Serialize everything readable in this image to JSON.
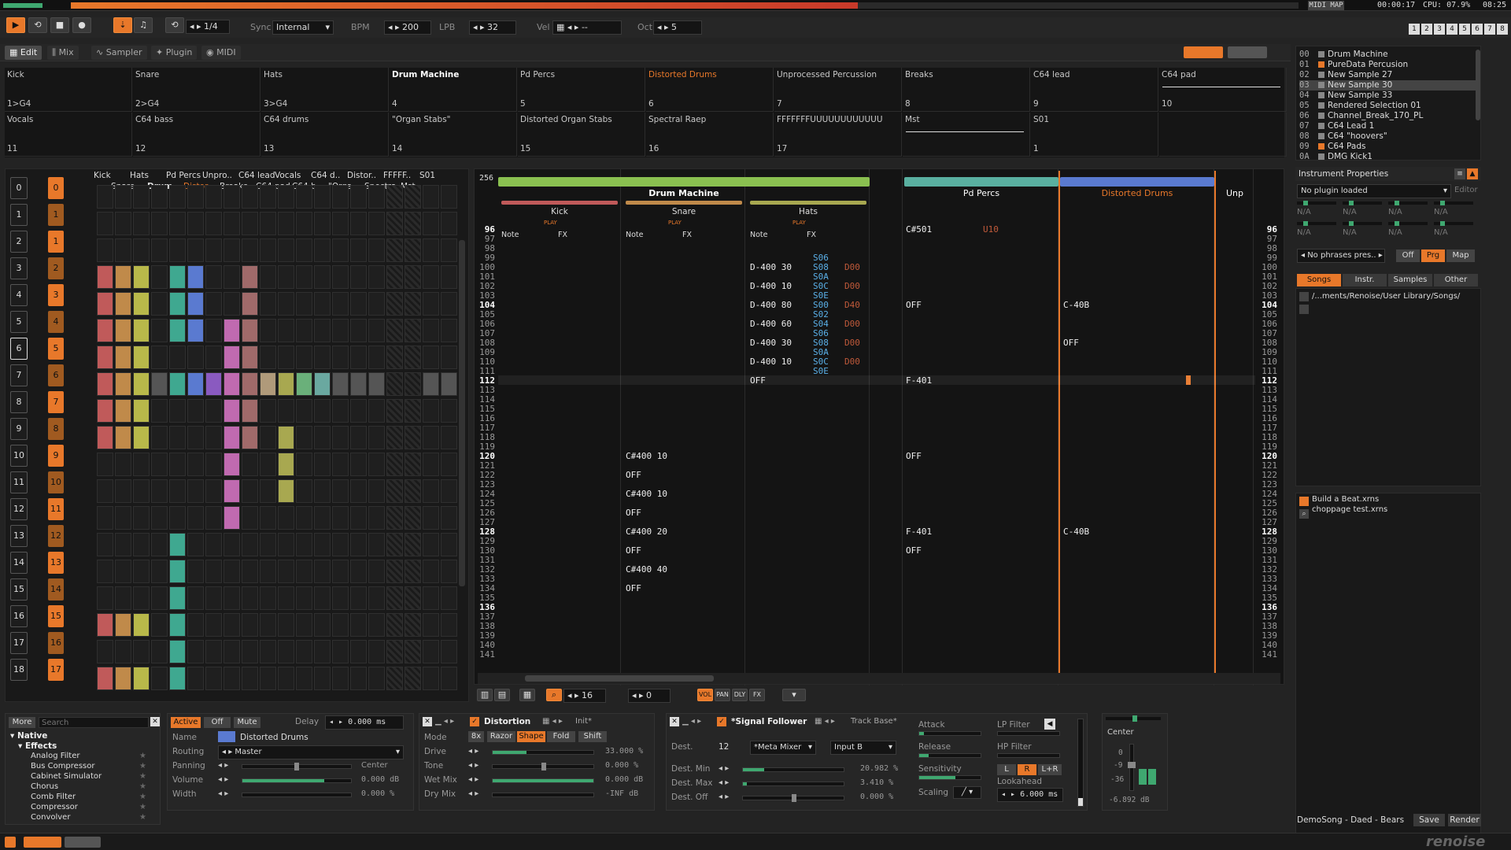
{
  "topbar": {
    "midi_map": "MIDI MAP",
    "time": "00:00:17",
    "cpu": "CPU: 07.9%",
    "clock": "08:25",
    "pages": [
      "1",
      "2",
      "3",
      "4",
      "5",
      "6",
      "7",
      "8"
    ]
  },
  "transport": {
    "pattern_pos": "1/4",
    "sync_label": "Sync",
    "sync_value": "Internal",
    "bpm_label": "BPM",
    "bpm": "200",
    "lpb_label": "LPB",
    "lpb": "32",
    "vel_label": "Vel",
    "vel": "--",
    "oct_label": "Oct",
    "oct": "5"
  },
  "tabs": {
    "edit": "Edit",
    "mix": "Mix",
    "sampler": "Sampler",
    "plugin": "Plugin",
    "midi": "MIDI"
  },
  "samples": [
    {
      "name": "Kick",
      "num": "1>G4"
    },
    {
      "name": "Snare",
      "num": "2>G4"
    },
    {
      "name": "Hats",
      "num": "3>G4"
    },
    {
      "name": "Drum Machine",
      "num": "4"
    },
    {
      "name": "Pd Percs",
      "num": "5"
    },
    {
      "name": "Distorted Drums",
      "num": "6"
    },
    {
      "name": "Unprocessed Percussion",
      "num": "7"
    },
    {
      "name": "Breaks",
      "num": "8"
    },
    {
      "name": "C64 lead",
      "num": "9"
    },
    {
      "name": "C64 pad",
      "num": "10"
    },
    {
      "name": "Vocals",
      "num": "11"
    },
    {
      "name": "C64 bass",
      "num": "12"
    },
    {
      "name": "C64 drums",
      "num": "13"
    },
    {
      "name": "\"Organ Stabs\"",
      "num": "14"
    },
    {
      "name": "Distorted Organ Stabs",
      "num": "15"
    },
    {
      "name": "Spectral Raep",
      "num": "16"
    },
    {
      "name": "FFFFFFFUUUUUUUUUUUU",
      "num": "17"
    },
    {
      "name": "Mst",
      "num": ""
    },
    {
      "name": "S01",
      "num": "1"
    },
    {
      "name": "",
      "num": ""
    }
  ],
  "matrix": {
    "headers_row1": [
      "Kick",
      "Hats",
      "Pd Percs",
      "Unpro..",
      "C64 lead",
      "Vocals",
      "C64 d..",
      "Distor..",
      "FFFFF..",
      "S01"
    ],
    "headers_row2": [
      "Snare",
      "Drum..",
      "Distor..",
      "Breaks",
      "C64 pad",
      "C64 b..",
      "\"Orga..",
      "Spectra..",
      "Mst"
    ],
    "seq": [
      "0",
      "1",
      "2",
      "3",
      "4",
      "5",
      "6",
      "7",
      "8",
      "9",
      "10",
      "11",
      "12",
      "13",
      "14",
      "15",
      "16",
      "17",
      "18"
    ],
    "pat": [
      "0",
      "1",
      "1",
      "2",
      "3",
      "4",
      "5",
      "6",
      "7",
      "8",
      "9",
      "10",
      "11",
      "12",
      "13",
      "14",
      "15",
      "16",
      "17"
    ],
    "play": "PLAY"
  },
  "pattern": {
    "lines": "256",
    "group_drum": "Drum Machine",
    "group_pd": "Pd Percs",
    "group_dist": "Distorted Drums",
    "group_unp": "Unp",
    "tracks": [
      "Kick",
      "Snare",
      "Hats"
    ],
    "col_note": "Note",
    "col_fx": "FX",
    "play": "PLAY",
    "rows": [
      "96",
      "97",
      "98",
      "99",
      "100",
      "101",
      "102",
      "103",
      "104",
      "105",
      "106",
      "107",
      "108",
      "109",
      "110",
      "111",
      "112",
      "113",
      "114",
      "115",
      "116",
      "117",
      "118",
      "119",
      "120",
      "121",
      "122",
      "123",
      "124",
      "125",
      "126",
      "127",
      "128",
      "129",
      "130",
      "131",
      "132",
      "133",
      "134",
      "135",
      "136",
      "137",
      "138",
      "139",
      "140",
      "141"
    ],
    "hats_notes": [
      "D-400 30",
      "D-400 10",
      "D-400 80",
      "D-400 60",
      "D-400 30",
      "D-400 10",
      "OFF"
    ],
    "hats_fx": [
      "S06",
      "S08",
      "S0A",
      "S0C",
      "S0E",
      "S00",
      "S02",
      "S04",
      "S06",
      "S08",
      "S0A",
      "S0C",
      "S0E"
    ],
    "hats_fx2": [
      "D00",
      "D00",
      "D40",
      "D00",
      "D00",
      "D00"
    ],
    "snare_notes": [
      "C#400 10",
      "OFF",
      "C#400 10",
      "OFF",
      "C#400 20",
      "OFF",
      "C#400 40",
      "OFF"
    ],
    "pd_notes": [
      "C#501",
      "OFF",
      "F-401",
      "OFF",
      "F-401",
      "OFF"
    ],
    "pd_fx": "U10",
    "dist_notes": [
      "C-40B",
      "OFF",
      "C-40B"
    ]
  },
  "pattern_toolbar": {
    "step": "16",
    "quant": "0",
    "vol": "VOL",
    "pan": "PAN",
    "dly": "DLY",
    "fx": "FX"
  },
  "browser": {
    "more": "More",
    "search_placeholder": "Search",
    "native": "Native",
    "effects": "Effects",
    "items": [
      "Analog Filter",
      "Bus Compressor",
      "Cabinet Simulator",
      "Chorus",
      "Comb Filter",
      "Compressor",
      "Convolver"
    ]
  },
  "track_panel": {
    "active": "Active",
    "off": "Off",
    "mute": "Mute",
    "delay_label": "Delay",
    "delay": "0.000 ms",
    "name_label": "Name",
    "name": "Distorted Drums",
    "routing_label": "Routing",
    "routing": "Master",
    "panning_label": "Panning",
    "panning": "Center",
    "volume_label": "Volume",
    "volume": "0.000 dB",
    "width_label": "Width",
    "width": "0.000 %"
  },
  "distortion": {
    "title": "Distortion",
    "preset": "Init*",
    "mode_label": "Mode",
    "modes": [
      "8x",
      "Razor",
      "Shape",
      "Fold",
      "Shift"
    ],
    "drive_label": "Drive",
    "drive": "33.000 %",
    "tone_label": "Tone",
    "tone": "0.000 %",
    "wet_label": "Wet Mix",
    "wet": "0.000 dB",
    "dry_label": "Dry Mix",
    "dry": "-INF dB"
  },
  "signal": {
    "title": "*Signal Follower",
    "trackbase": "Track Base*",
    "dest_label": "Dest.",
    "dest": "12",
    "meta": "*Meta Mixer",
    "input": "Input B",
    "min_label": "Dest. Min",
    "min": "20.982 %",
    "max_label": "Dest. Max",
    "max": "3.410 %",
    "off_label": "Dest. Off",
    "offv": "0.000 %",
    "attack": "Attack",
    "release": "Release",
    "sensitivity": "Sensitivity",
    "scaling": "Scaling",
    "lp": "LP Filter",
    "hp": "HP Filter",
    "l": "L",
    "r": "R",
    "lr": "L+R",
    "lookahead": "Lookahead",
    "look_val": "6.000 ms"
  },
  "meter": {
    "center": "Center",
    "db0": "0",
    "db9": "-9",
    "db36": "-36",
    "val": "-6.892 dB"
  },
  "instruments": [
    {
      "id": "00",
      "name": "Drum Machine",
      "color": "#888888"
    },
    {
      "id": "01",
      "name": "PureData Percusion",
      "color": "#e8782a"
    },
    {
      "id": "02",
      "name": "New Sample 27",
      "color": "#888888"
    },
    {
      "id": "03",
      "name": "New Sample 30",
      "color": "#888888"
    },
    {
      "id": "04",
      "name": "New Sample 33",
      "color": "#888888"
    },
    {
      "id": "05",
      "name": "Rendered Selection 01",
      "color": "#888888"
    },
    {
      "id": "06",
      "name": "Channel_Break_170_PL",
      "color": "#888888"
    },
    {
      "id": "07",
      "name": "C64 Lead 1",
      "color": "#888888"
    },
    {
      "id": "08",
      "name": "C64 \"hoovers\"",
      "color": "#888888"
    },
    {
      "id": "09",
      "name": "C64 Pads",
      "color": "#e8782a"
    },
    {
      "id": "0A",
      "name": "DMG Kick1",
      "color": "#888888"
    }
  ],
  "inst_props": {
    "title": "Instrument Properties",
    "plugin": "No plugin loaded",
    "editor": "Editor",
    "na": "N/A",
    "phrases": "No phrases pres..",
    "off": "Off",
    "prg": "Prg",
    "map": "Map"
  },
  "disk": {
    "tabs": [
      "Songs",
      "Instr.",
      "Samples",
      "Other"
    ],
    "path": "/...ments/Renoise/User Library/Songs/",
    "files": [
      "Build a Beat.xrns",
      "choppage test.xrns"
    ]
  },
  "song": {
    "name": "DemoSong - Daed - Bears",
    "save": "Save",
    "render": "Render"
  },
  "logo": "renoise"
}
